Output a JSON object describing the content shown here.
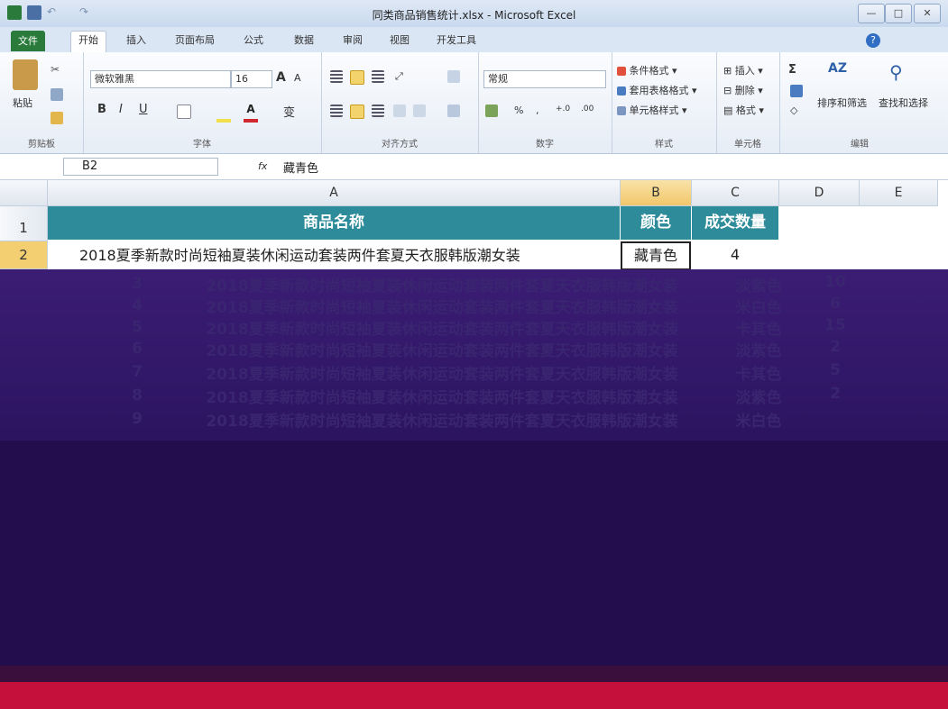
{
  "window": {
    "title": "同类商品销售统计.xlsx - Microsoft Excel",
    "controls": [
      "—",
      "□",
      "✕"
    ]
  },
  "tabs": [
    "文件",
    "开始",
    "插入",
    "页面布局",
    "公式",
    "数据",
    "审阅",
    "视图",
    "开发工具"
  ],
  "ribbon": {
    "clipboard": {
      "paste": "粘贴",
      "label": "剪贴板"
    },
    "font": {
      "name": "微软雅黑",
      "size": "16",
      "bold": "B",
      "italic": "I",
      "underline": "U",
      "label": "字体",
      "grow": "A",
      "shrink": "A",
      "phonetic": "变"
    },
    "alignment": {
      "label": "对齐方式"
    },
    "number": {
      "format": "常规",
      "percent": "%",
      "comma": ",",
      "inc": "+.0",
      "dec": ".00",
      "label": "数字"
    },
    "styles": {
      "cond": "条件格式",
      "table": "套用表格格式",
      "cell": "单元格样式",
      "label": "样式"
    },
    "cells": {
      "insert": "插入",
      "delete": "删除",
      "format": "格式",
      "label": "单元格"
    },
    "editing": {
      "sum": "Σ",
      "sort": "排序和筛选",
      "find": "查找和选择",
      "label": "编辑"
    }
  },
  "formula_bar": {
    "name_box": "B2",
    "fx": "fx",
    "content": "藏青色"
  },
  "columns": [
    "A",
    "B",
    "C",
    "D",
    "E"
  ],
  "header_row": {
    "num": "1",
    "a": "商品名称",
    "b": "颜色",
    "c": "成交数量"
  },
  "row2": {
    "num": "2",
    "a": "2018夏季新款时尚短袖夏装休闲运动套装两件套夏天衣服韩版潮女装",
    "b": "藏青色",
    "c": "4"
  },
  "glitch_rows": [
    {
      "num": "3",
      "a": "2018夏季新款时尚短袖夏装休闲运动套装两件套夏天衣服韩版潮女装",
      "b": "淡紫色",
      "c": "10"
    },
    {
      "num": "4",
      "a": "2018夏季新款时尚短袖夏装休闲运动套装两件套夏天衣服韩版潮女装",
      "b": "米白色",
      "c": "6"
    },
    {
      "num": "5",
      "a": "2018夏季新款时尚短袖夏装休闲运动套装两件套夏天衣服韩版潮女装",
      "b": "卡其色",
      "c": "15"
    },
    {
      "num": "6",
      "a": "2018夏季新款时尚短袖夏装休闲运动套装两件套夏天衣服韩版潮女装",
      "b": "淡紫色",
      "c": "2"
    },
    {
      "num": "7",
      "a": "2018夏季新款时尚短袖夏装休闲运动套装两件套夏天衣服韩版潮女装",
      "b": "卡其色",
      "c": "5"
    },
    {
      "num": "8",
      "a": "2018夏季新款时尚短袖夏装休闲运动套装两件套夏天衣服韩版潮女装",
      "b": "淡紫色",
      "c": "2"
    },
    {
      "num": "9",
      "a": "2018夏季新款时尚短袖夏装休闲运动套装两件套夏天衣服韩版潮女装",
      "b": "米白色",
      "c": ""
    }
  ]
}
